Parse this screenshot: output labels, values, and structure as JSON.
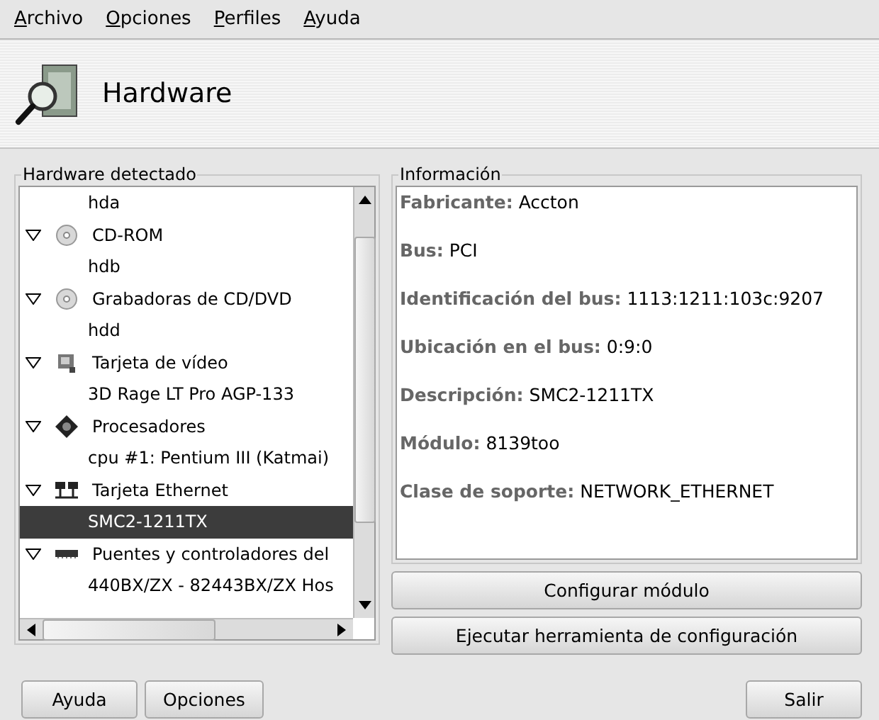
{
  "menu": [
    {
      "label": "Archivo"
    },
    {
      "label": "Opciones"
    },
    {
      "label": "Perfiles"
    },
    {
      "label": "Ayuda"
    }
  ],
  "header": {
    "title": "Hardware"
  },
  "tree": {
    "title": "Hardware detectado",
    "items": [
      {
        "children": [
          {
            "label": "hda",
            "selected": false
          }
        ]
      },
      {
        "label": "CD-ROM",
        "kind": "disc",
        "expanded": true,
        "selected": false,
        "children": [
          {
            "label": "hdb",
            "selected": false
          }
        ]
      },
      {
        "label": "Grabadoras de CD/DVD",
        "kind": "disc",
        "expanded": true,
        "selected": false,
        "children": [
          {
            "label": "hdd",
            "selected": false
          }
        ]
      },
      {
        "label": "Tarjeta de vídeo",
        "kind": "video",
        "expanded": true,
        "selected": false,
        "children": [
          {
            "label": "3D Rage LT Pro AGP-133",
            "selected": false
          }
        ]
      },
      {
        "label": "Procesadores",
        "kind": "cpu",
        "expanded": true,
        "selected": false,
        "children": [
          {
            "label": "cpu #1: Pentium III (Katmai)",
            "selected": false
          }
        ]
      },
      {
        "label": "Tarjeta Ethernet",
        "kind": "network",
        "expanded": true,
        "selected": false,
        "children": [
          {
            "label": "SMC2-1211TX",
            "selected": true
          }
        ]
      },
      {
        "label": "Puentes y controladores del",
        "kind": "bridge",
        "expanded": true,
        "selected": false,
        "children": [
          {
            "label": "440BX/ZX - 82443BX/ZX Hos",
            "selected": false
          }
        ]
      }
    ]
  },
  "info": {
    "title": "Información",
    "lines": [
      "**Fabricante:** Accton",
      "**Bus:** PCI",
      "**Identificación del bus:** 1113:1211:103c:9207",
      "**Ubicación en el bus:** 0:9:0",
      "**Descripción:** SMC2-1211TX",
      "**Módulo:** 8139too",
      "**Clase de soporte:** NETWORK_ETHERNET"
    ]
  },
  "actions": [
    "Configurar módulo",
    "Ejecutar herramienta de configuración"
  ],
  "footer": {
    "left": [
      "Ayuda",
      "Opciones"
    ],
    "right": [
      "Salir"
    ]
  }
}
